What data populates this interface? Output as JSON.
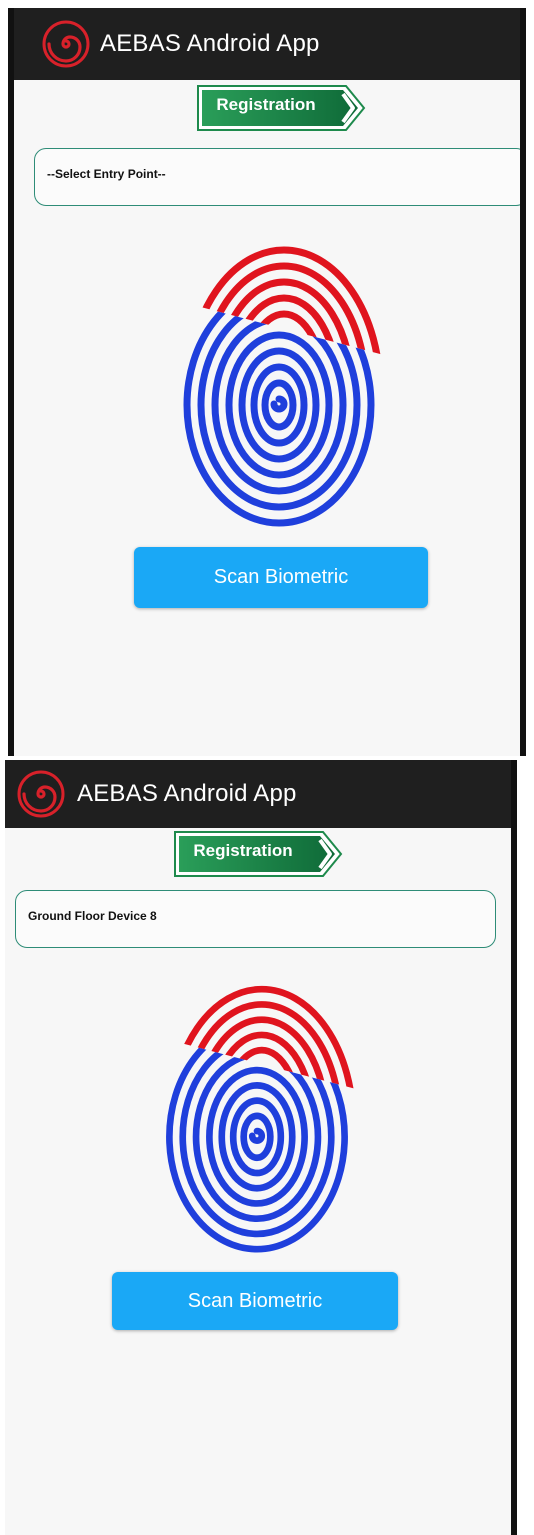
{
  "screens": [
    {
      "appbar": {
        "title": "AEBAS Android App",
        "logo_icon": "spiral-logo-icon"
      },
      "registration_label": "Registration",
      "entry_point": {
        "value": "--Select Entry Point--"
      },
      "scan_button_label": "Scan Biometric"
    },
    {
      "appbar": {
        "title": "AEBAS Android App",
        "logo_icon": "spiral-logo-icon"
      },
      "registration_label": "Registration",
      "entry_point": {
        "value": "Ground Floor Device 8"
      },
      "scan_button_label": "Scan Biometric"
    }
  ],
  "colors": {
    "appbar": "#1f1f1f",
    "logo": "#d8212a",
    "registration_badge": "#1e8a4c",
    "select_border": "#2e8c77",
    "scan_button": "#1aa8f6",
    "fingerprint_top": "#e0141e",
    "fingerprint_bottom": "#1f3fdc"
  }
}
